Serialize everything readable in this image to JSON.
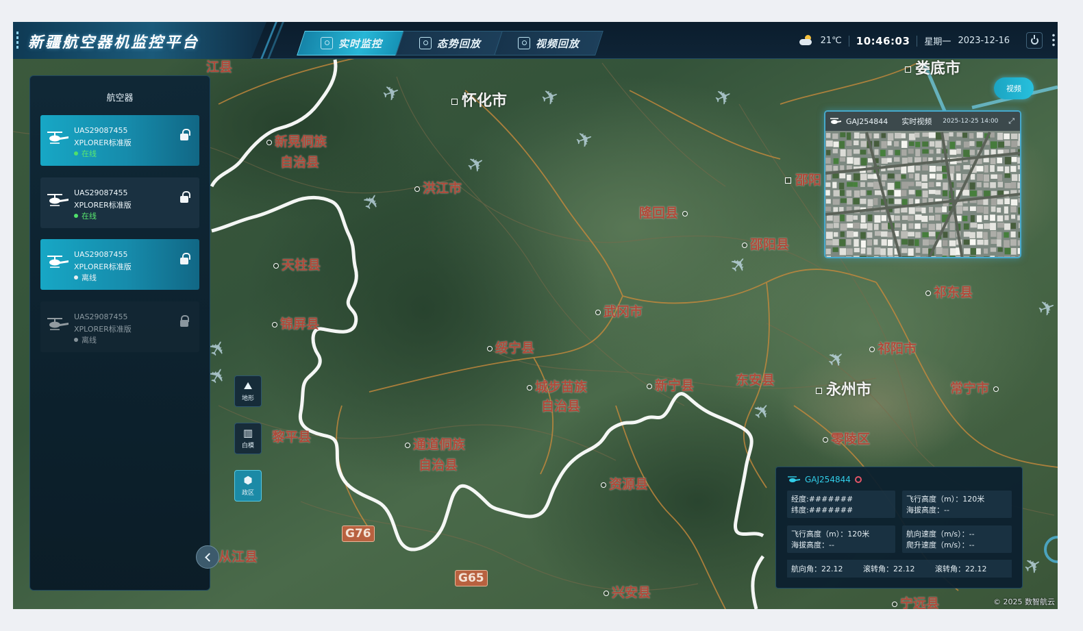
{
  "brand": {
    "title": "新疆航空器机监控平台"
  },
  "tabs": [
    {
      "label": "实时监控",
      "icon": "monitor-icon",
      "active": true
    },
    {
      "label": "态势回放",
      "icon": "situation-icon",
      "active": false
    },
    {
      "label": "视频回放",
      "icon": "video-replay-icon",
      "active": false
    }
  ],
  "status": {
    "weather_icon": "partly-cloudy-icon",
    "temperature": "21℃",
    "time": "10:46:03",
    "weekday": "星期一",
    "date": "2023-12-16"
  },
  "left_panel": {
    "title": "航空器",
    "aircraft": [
      {
        "id": "UAS29087455",
        "model": "XPLORER标准版",
        "status": "在线",
        "state": "online",
        "selected": true,
        "lock": "unlocked"
      },
      {
        "id": "UAS29087455",
        "model": "XPLORER标准版",
        "status": "在线",
        "state": "online",
        "selected": false,
        "lock": "unlocked"
      },
      {
        "id": "UAS29087455",
        "model": "XPLORER标准版",
        "status": "离线",
        "state": "offline",
        "selected": true,
        "lock": "unlocked"
      },
      {
        "id": "UAS29087455",
        "model": "XPLORER标准版",
        "status": "离线",
        "state": "disabled",
        "selected": false,
        "lock": "locked"
      }
    ]
  },
  "map_tools": [
    {
      "label": "地形",
      "icon": "terrain-icon",
      "active": false
    },
    {
      "label": "白模",
      "icon": "building-icon",
      "active": false
    },
    {
      "label": "政区",
      "icon": "region-icon",
      "active": true
    }
  ],
  "map": {
    "places": [
      {
        "name": "怀化市",
        "marker": "square",
        "big": true
      },
      {
        "name": "新晃侗族",
        "marker": "dot"
      },
      {
        "name": "自治县",
        "marker": "none"
      },
      {
        "name": "洪江市",
        "marker": "dot"
      },
      {
        "name": "隆回县",
        "marker": "dot-right"
      },
      {
        "name": "邵阳县",
        "marker": "dot"
      },
      {
        "name": "邵阳",
        "marker": "square"
      },
      {
        "name": "天柱县",
        "marker": "dot"
      },
      {
        "name": "锦屏县",
        "marker": "dot"
      },
      {
        "name": "武冈市",
        "marker": "dot"
      },
      {
        "name": "绥宁县",
        "marker": "dot"
      },
      {
        "name": "城步苗族",
        "marker": "dot"
      },
      {
        "name": "自治县",
        "marker": "none"
      },
      {
        "name": "新宁县",
        "marker": "dot"
      },
      {
        "name": "东安县",
        "marker": "none"
      },
      {
        "name": "祁东县",
        "marker": "dot"
      },
      {
        "name": "祁阳市",
        "marker": "dot"
      },
      {
        "name": "永州市",
        "marker": "square",
        "big": true
      },
      {
        "name": "常宁市",
        "marker": "dot-right"
      },
      {
        "name": "零陵区",
        "marker": "dot"
      },
      {
        "name": "黎平县",
        "marker": "dot"
      },
      {
        "name": "通道侗族",
        "marker": "dot"
      },
      {
        "name": "自治县",
        "marker": "none"
      },
      {
        "name": "资源县",
        "marker": "dot"
      },
      {
        "name": "从江县",
        "marker": "none"
      },
      {
        "name": "兴安县",
        "marker": "dot"
      },
      {
        "name": "宁远县",
        "marker": "dot"
      },
      {
        "name": "娄底市",
        "marker": "none",
        "big": true
      },
      {
        "name": "江县",
        "marker": "none"
      }
    ],
    "roads": [
      "G76",
      "G65"
    ]
  },
  "video": {
    "button_label": "视频",
    "aircraft_id": "GAJ254844",
    "label": "实时视频",
    "timestamp": "2025-12-25 14:00"
  },
  "info": {
    "aircraft_id": "GAJ254844",
    "cells": [
      {
        "line1": "经度:#######",
        "line2": "纬度:#######"
      },
      {
        "line1": "飞行高度（m）：120米",
        "line2": "海拔高度：--"
      },
      {
        "line1": "飞行高度（m）：120米",
        "line2": "海拔高度：--"
      },
      {
        "line1": "航向速度（m/s）：--",
        "line2": "爬升速度（m/s）：--"
      }
    ],
    "angles": [
      "航向角：22.12",
      "滚转角：22.12",
      "滚转角：22.12"
    ]
  },
  "copyright": "© 2025 数智航云",
  "colors": {
    "accent": "#1ab0cf",
    "online": "#4fe06a",
    "brand": "#1b5a7a"
  }
}
